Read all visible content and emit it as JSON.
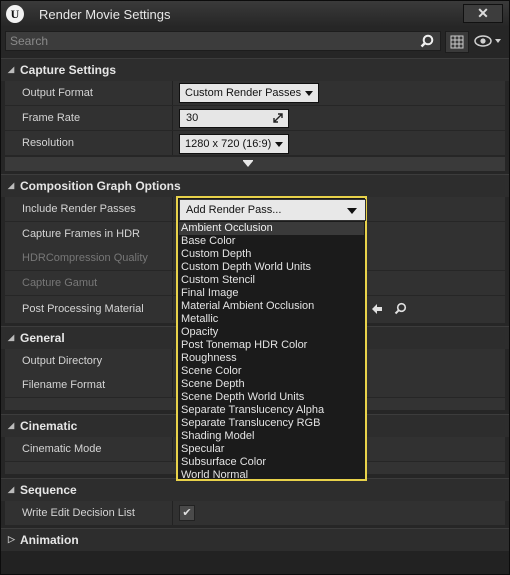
{
  "window": {
    "title": "Render Movie Settings",
    "logo": "U",
    "close": "✕"
  },
  "search": {
    "placeholder": "Search"
  },
  "sections": {
    "capture": {
      "title": "Capture Settings",
      "rows": {
        "output_format": {
          "label": "Output Format",
          "value": "Custom Render Passes"
        },
        "frame_rate": {
          "label": "Frame Rate",
          "value": "30"
        },
        "resolution": {
          "label": "Resolution",
          "value": "1280 x 720 (16:9)"
        }
      }
    },
    "composition": {
      "title": "Composition Graph Options",
      "rows": {
        "include_passes": {
          "label": "Include Render Passes",
          "value": "Add Render Pass..."
        },
        "capture_hdr": {
          "label": "Capture Frames in HDR"
        },
        "hdr_quality": {
          "label": "HDRCompression Quality"
        },
        "capture_gamut": {
          "label": "Capture Gamut"
        },
        "post_processing": {
          "label": "Post Processing Material"
        }
      }
    },
    "general": {
      "title": "General",
      "rows": {
        "output_directory": {
          "label": "Output Directory"
        },
        "filename_format": {
          "label": "Filename Format"
        }
      }
    },
    "cinematic": {
      "title": "Cinematic",
      "rows": {
        "cinematic_mode": {
          "label": "Cinematic Mode"
        }
      }
    },
    "sequence": {
      "title": "Sequence",
      "rows": {
        "edl": {
          "label": "Write Edit Decision List",
          "checked": true
        }
      }
    },
    "animation": {
      "title": "Animation"
    }
  },
  "dropdown": {
    "items": [
      "Ambient Occlusion",
      "Base Color",
      "Custom Depth",
      "Custom Depth World Units",
      "Custom Stencil",
      "Final Image",
      "Material Ambient Occlusion",
      "Metallic",
      "Opacity",
      "Post Tonemap HDR Color",
      "Roughness",
      "Scene Color",
      "Scene Depth",
      "Scene Depth World Units",
      "Separate Translucency Alpha",
      "Separate Translucency RGB",
      "Shading Model",
      "Specular",
      "Subsurface Color",
      "World Normal"
    ],
    "highlighted_index": 0,
    "border_color": "#e8d24a"
  }
}
